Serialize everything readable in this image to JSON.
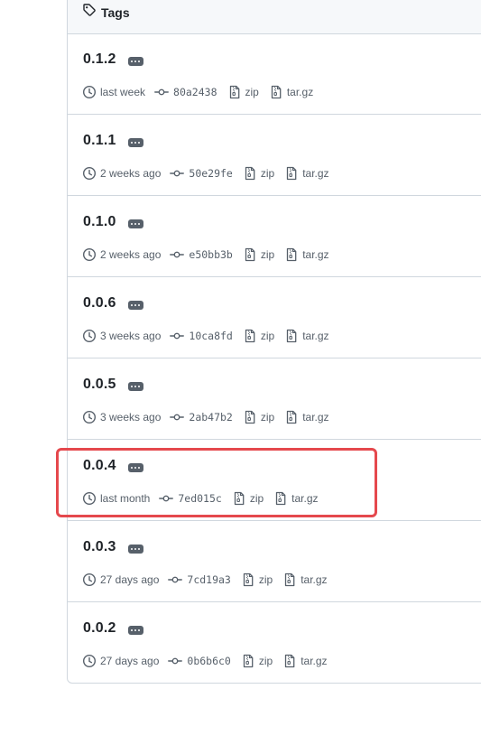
{
  "panel": {
    "title": "Tags"
  },
  "tags": [
    {
      "name": "0.1.2",
      "time": "last week",
      "sha": "80a2438",
      "zip": "zip",
      "targz": "tar.gz"
    },
    {
      "name": "0.1.1",
      "time": "2 weeks ago",
      "sha": "50e29fe",
      "zip": "zip",
      "targz": "tar.gz"
    },
    {
      "name": "0.1.0",
      "time": "2 weeks ago",
      "sha": "e50bb3b",
      "zip": "zip",
      "targz": "tar.gz"
    },
    {
      "name": "0.0.6",
      "time": "3 weeks ago",
      "sha": "10ca8fd",
      "zip": "zip",
      "targz": "tar.gz"
    },
    {
      "name": "0.0.5",
      "time": "3 weeks ago",
      "sha": "2ab47b2",
      "zip": "zip",
      "targz": "tar.gz"
    },
    {
      "name": "0.0.4",
      "time": "last month",
      "sha": "7ed015c",
      "zip": "zip",
      "targz": "tar.gz",
      "highlighted": true
    },
    {
      "name": "0.0.3",
      "time": "27 days ago",
      "sha": "7cd19a3",
      "zip": "zip",
      "targz": "tar.gz"
    },
    {
      "name": "0.0.2",
      "time": "27 days ago",
      "sha": "0b6b6c0",
      "zip": "zip",
      "targz": "tar.gz"
    }
  ],
  "icons": {
    "header": "tag-icon",
    "time": "clock-icon",
    "commit": "git-commit-icon",
    "archive": "file-zip-icon",
    "more": "kebab-horizontal-icon"
  },
  "colors": {
    "text": "#1f2328",
    "muted": "#57606a",
    "border": "#d0d7de",
    "header_bg": "#f6f8fa",
    "highlight": "#e5484d"
  }
}
